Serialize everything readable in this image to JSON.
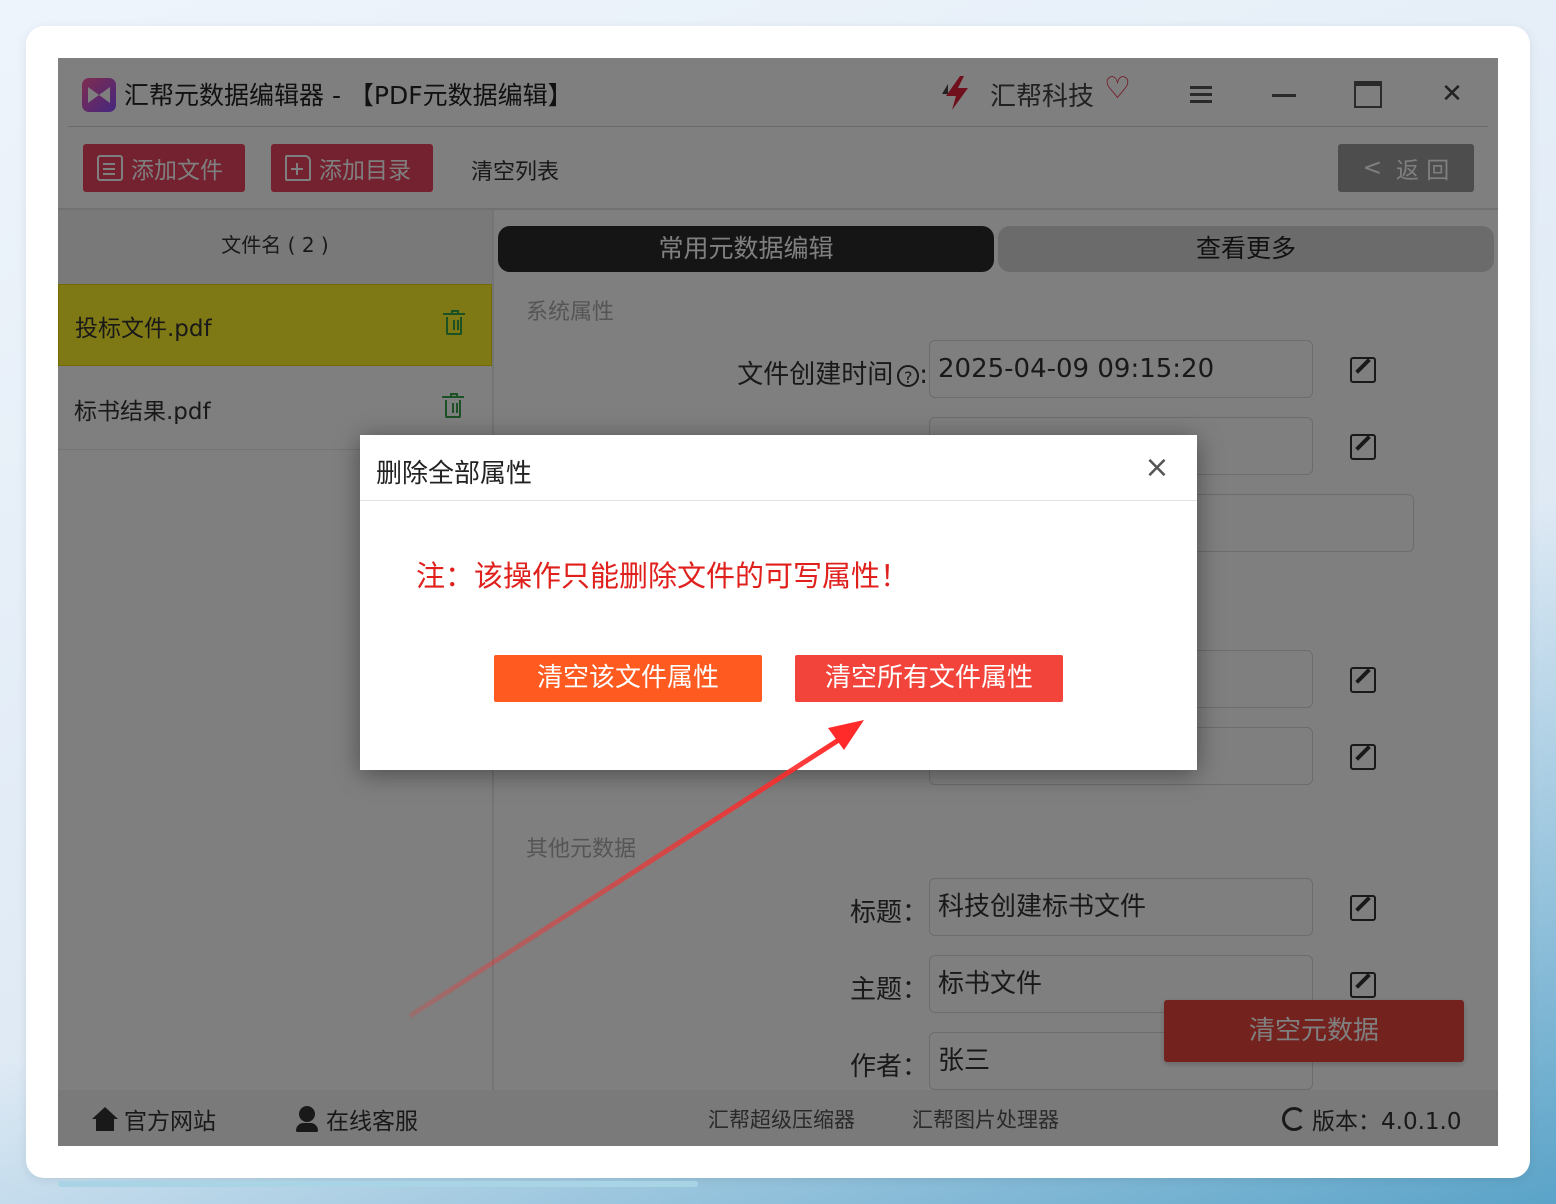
{
  "window": {
    "title": "汇帮元数据编辑器 - 【PDF元数据编辑】",
    "brand": "汇帮科技"
  },
  "toolbar": {
    "add_file": "添加文件",
    "add_dir": "添加目录",
    "clear_list": "清空列表",
    "back": "返 回",
    "back_icon": "<"
  },
  "file_list": {
    "header": "文件名 ( 2 )",
    "files": [
      {
        "name": "投标文件.pdf",
        "selected": true
      },
      {
        "name": "标书结果.pdf",
        "selected": false
      }
    ]
  },
  "tabs": {
    "common": "常用元数据编辑",
    "more": "查看更多"
  },
  "system_props": {
    "label": "系统属性",
    "created_label": "文件创建时间",
    "created_value": "2025-04-09 09:15:20"
  },
  "other_meta": {
    "label": "其他元数据",
    "fields": [
      {
        "label": "标题：",
        "value": "科技创建标书文件"
      },
      {
        "label": "主题：",
        "value": "标书文件"
      },
      {
        "label": "作者：",
        "value": "张三"
      }
    ]
  },
  "clear_metadata_button": "清空元数据",
  "footer": {
    "website": "官方网站",
    "support": "在线客服",
    "link1": "汇帮超级压缩器",
    "link2": "汇帮图片处理器",
    "version": "版本：4.0.1.0"
  },
  "dialog": {
    "title": "删除全部属性",
    "close": "×",
    "note": "注：该操作只能删除文件的可写属性！",
    "btn_this": "清空该文件属性",
    "btn_all": "清空所有文件属性"
  },
  "colors": {
    "accent_red": "#e8455f",
    "selected_row": "#fff22a",
    "note_red": "#e0201c",
    "annotation_arrow": "#ff2a2a"
  }
}
